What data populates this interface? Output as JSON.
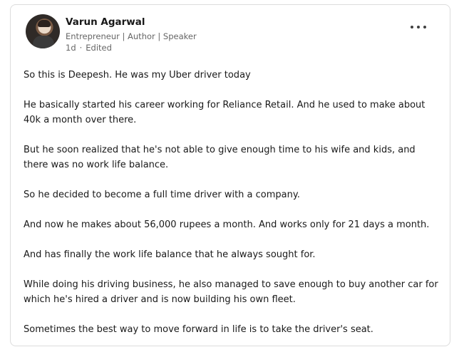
{
  "post": {
    "author": {
      "name": "Varun Agarwal",
      "headline": "Entrepreneur | Author | Speaker",
      "time": "1d",
      "separator": "·",
      "edited": "Edited"
    },
    "paragraphs": [
      "So this is Deepesh. He was my Uber driver today",
      "He basically started his career working for Reliance Retail. And he used to make about 40k a month over there.",
      "But he soon realized that he's not able to give enough time to his wife and kids, and there was no work life balance.",
      "So he decided to become a full time driver with a company.",
      "And now he makes about 56,000 rupees a month. And works only for 21 days a month.",
      "And has finally the work life balance that he always sought for.",
      "While doing his driving business, he also managed to save enough to buy another car for which he's hired a driver and is now building his own fleet.",
      "Sometimes the best way to move forward in life is to take the driver's seat."
    ],
    "icons": {
      "more": "more-horizontal-icon"
    }
  }
}
